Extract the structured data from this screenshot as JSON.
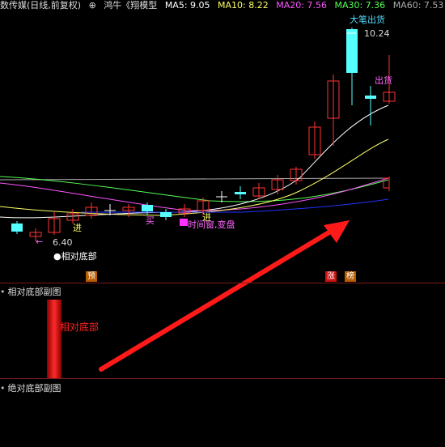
{
  "header": {
    "stock": "数传媒(日线,前复权)",
    "formula_icon": "circle-plus-icon",
    "formula": "鸿牛《翔模型",
    "ma5": "MA5: 9.05",
    "ma10": "MA10: 8.22",
    "ma20": "MA20: 7.56",
    "ma30": "MA30: 7.36",
    "ma60": "MA60: 7.53"
  },
  "colors": {
    "ma5": "#ffffff",
    "ma10": "#ffff66",
    "ma20": "#ff55ff",
    "ma30": "#55ff55",
    "ma60": "#aaaaaa",
    "up": "#ff3333",
    "down": "#55ffff",
    "accent_red": "#ff2222",
    "panel_line": "#7a1a1a"
  },
  "annotations": {
    "big_sell": "大笔出货",
    "high_price": "10.24",
    "sell": "出货",
    "low_price": "6.40",
    "enter": "进",
    "enter2": "进",
    "buy": "买",
    "window": "时间窗,变盘",
    "rel_bottom": "相对底部"
  },
  "badges": {
    "yu": "预",
    "zhang": "涨",
    "bang": "榜"
  },
  "sub1": {
    "title": "相对底部副图",
    "bar_label": "相对底部"
  },
  "sub2": {
    "title": "绝对底部副图"
  }
}
